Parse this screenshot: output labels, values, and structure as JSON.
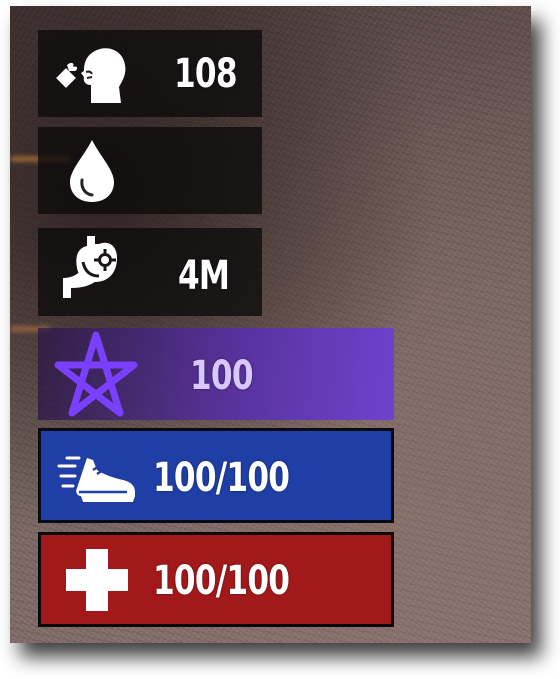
{
  "hud": {
    "stamina": {
      "icon": "person-coughing-icon",
      "value": "108"
    },
    "thirst": {
      "icon": "water-drop-icon",
      "value": ""
    },
    "hunger": {
      "icon": "stomach-icon",
      "value": "4M"
    },
    "mana": {
      "icon": "pentagram-icon",
      "value": "100",
      "color": "#6d36d9"
    },
    "speed": {
      "icon": "running-shoe-icon",
      "value": "100/100",
      "color": "#1f3fa6"
    },
    "health": {
      "icon": "medical-cross-icon",
      "value": "100/100",
      "color": "#a3191b"
    }
  }
}
